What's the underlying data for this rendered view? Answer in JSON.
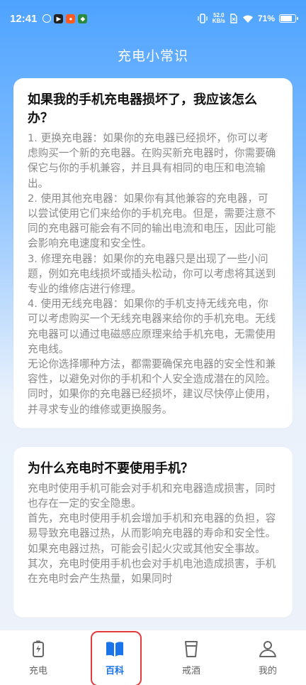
{
  "status": {
    "time": "12:41",
    "speed_value": "52.0",
    "speed_unit": "KB/s",
    "battery": "71%"
  },
  "page": {
    "title": "充电小常识"
  },
  "cards": [
    {
      "title": "如果我的手机充电器损坏了，我应该怎么办？",
      "paragraphs": [
        "1. 更换充电器：如果你的充电器已经损坏，你可以考虑购买一个新的充电器。在购买新充电器时，你需要确保它与你的手机兼容，并且具有相同的电压和电流输出。",
        "2. 使用其他充电器：如果你有其他兼容的充电器，可以尝试使用它们来给你的手机充电。但是，需要注意不同的充电器可能会有不同的输出电流和电压，因此可能会影响充电速度和安全性。",
        "3. 修理充电器：如果你的充电器只是出现了一些小问题，例如充电线损坏或插头松动，你可以考虑将其送到专业的维修店进行修理。",
        "4. 使用无线充电器：如果你的手机支持无线充电，你可以考虑购买一个无线充电器来给你的手机充电。无线充电器可以通过电磁感应原理来给手机充电，无需使用充电线。",
        "无论你选择哪种方法，都需要确保充电器的安全性和兼容性，以避免对你的手机和个人安全造成潜在的风险。同时，如果你的充电器已经损坏，建议尽快停止使用，并寻求专业的维修或更换服务。"
      ]
    },
    {
      "title": "为什么充电时不要使用手机？",
      "paragraphs": [
        "充电时使用手机可能会对手机和充电器造成损害，同时也存在一定的安全隐患。",
        "首先，充电时使用手机会增加手机和充电器的负担，容易导致充电器过热，从而影响充电器的寿命和安全性。如果充电器过热，可能会引起火灾或其他安全事故。",
        "其次，充电时使用手机也会对手机电池造成损害，手机在充电时会产生热量，如果同时"
      ]
    }
  ],
  "tabs": [
    {
      "label": "充电",
      "icon": "battery-charging-icon",
      "active": false
    },
    {
      "label": "百科",
      "icon": "open-book-icon",
      "active": true
    },
    {
      "label": "戒酒",
      "icon": "cup-icon",
      "active": false
    },
    {
      "label": "我的",
      "icon": "user-icon",
      "active": false
    }
  ],
  "colors": {
    "accent": "#1a73e8",
    "highlight": "#e23b3b"
  }
}
